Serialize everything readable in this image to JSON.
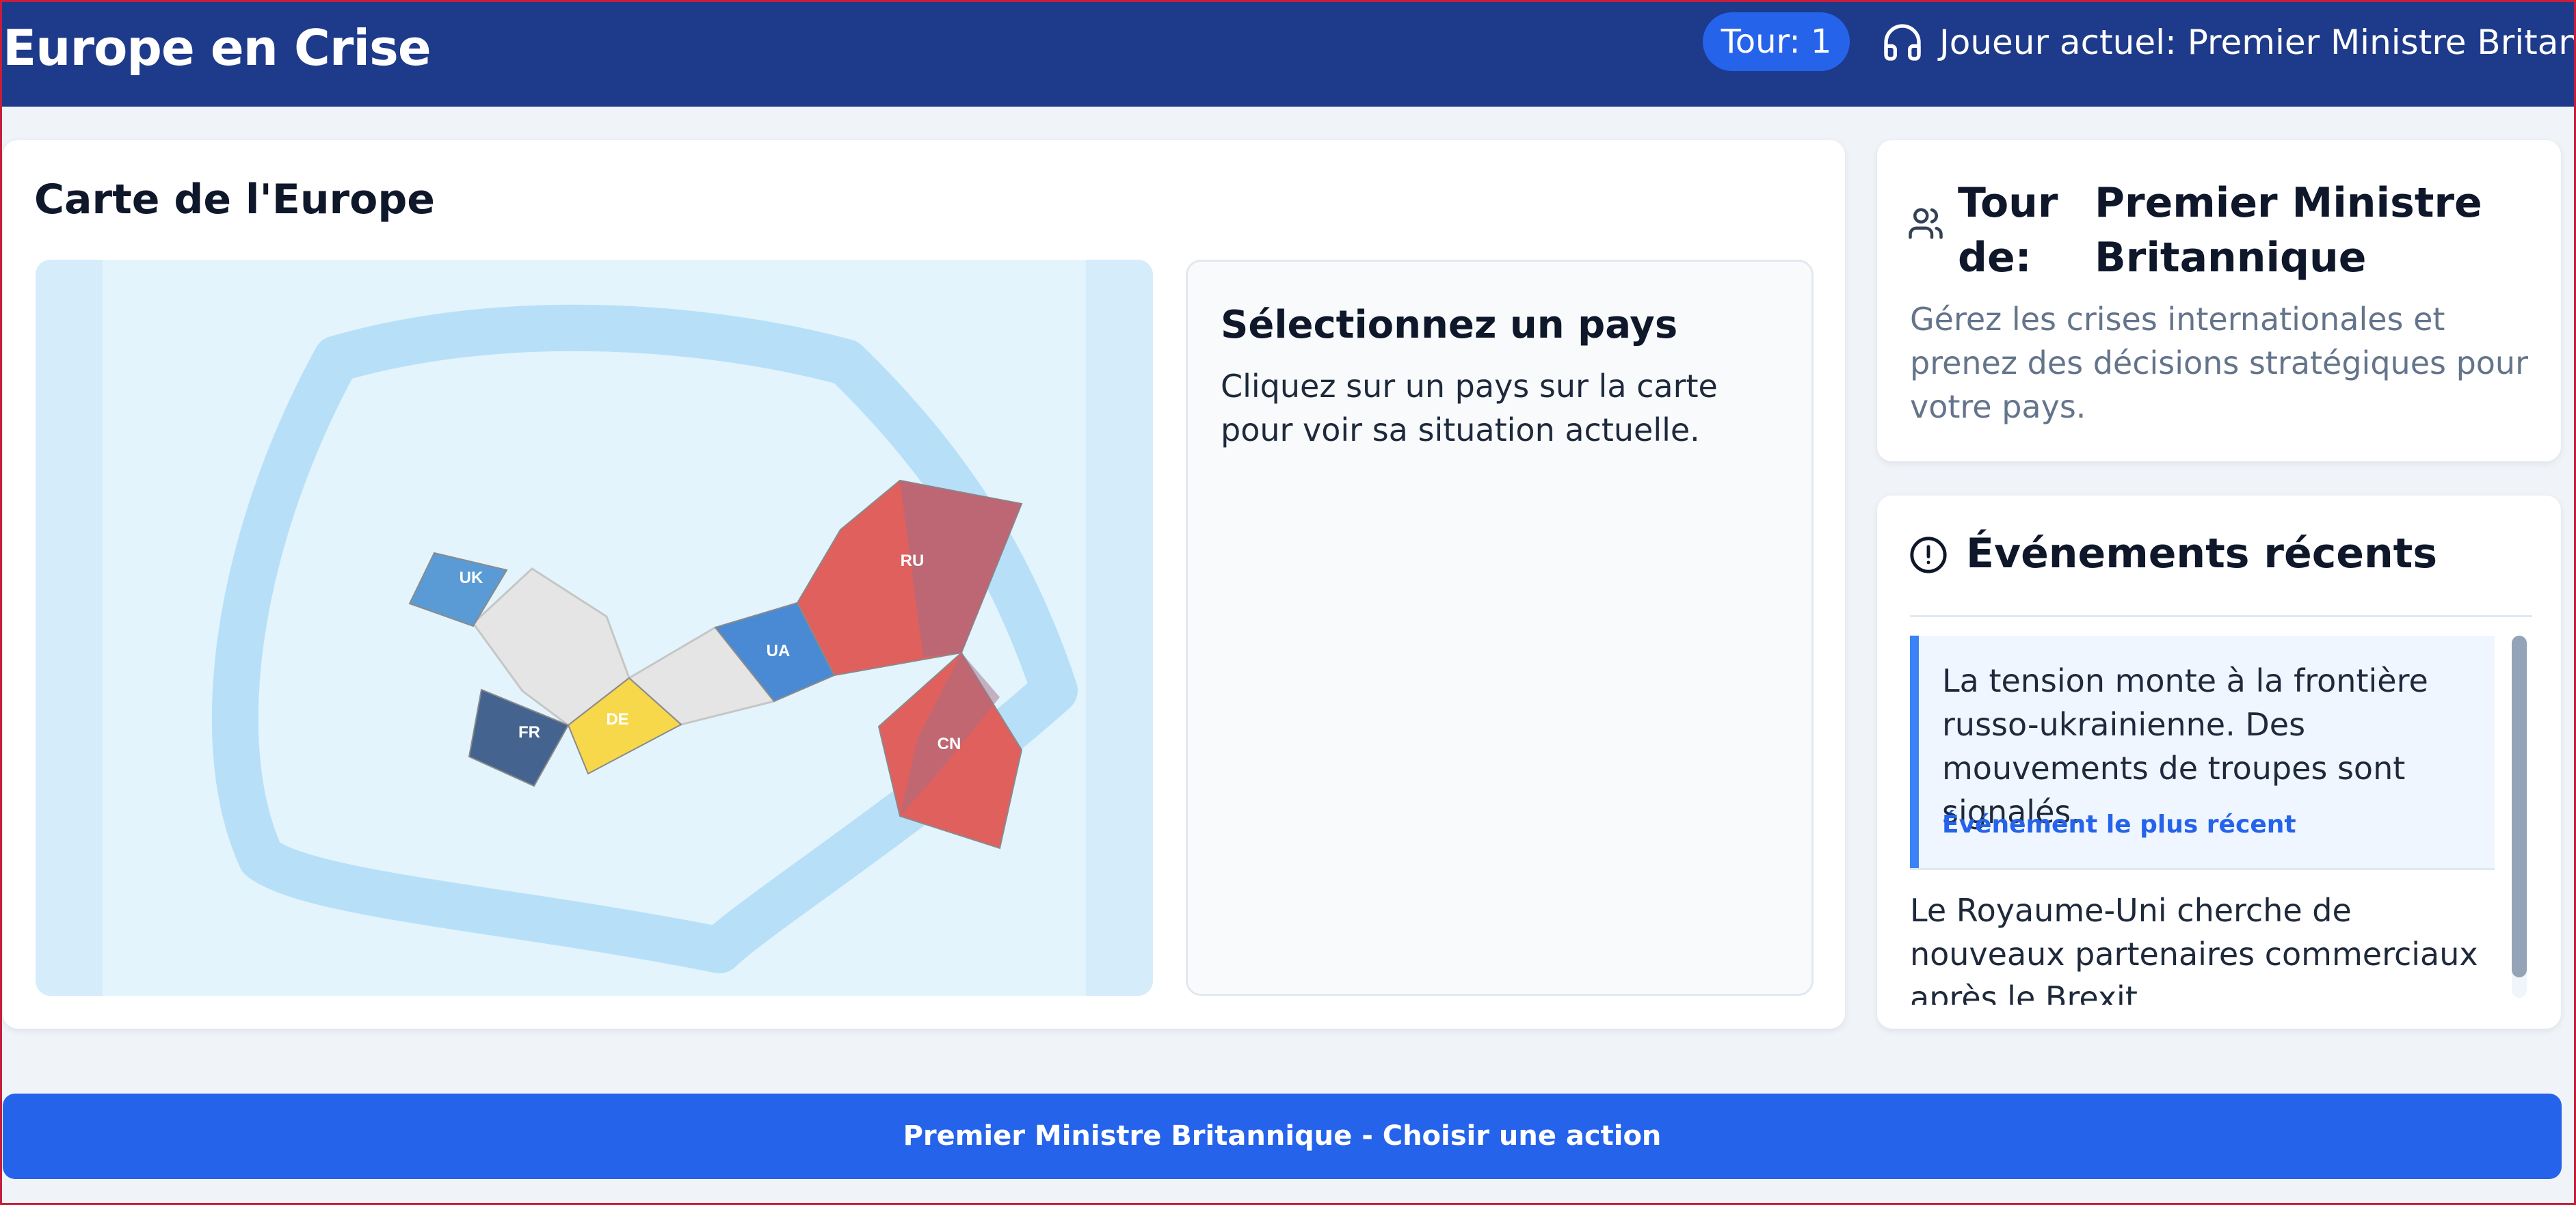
{
  "app": {
    "title": "Europe en Crise",
    "tour_badge": "Tour: 1",
    "current_player_label": "Joueur actuel: Premier Ministre Britannique"
  },
  "map": {
    "title": "Carte de l'Europe",
    "countries": [
      {
        "code": "UK",
        "color": "#5b9bd5"
      },
      {
        "code": "FR",
        "color": "#44648f"
      },
      {
        "code": "DE",
        "color": "#f7d84a"
      },
      {
        "code": "UA",
        "color": "#4a8ad4"
      },
      {
        "code": "RU",
        "color": "#e0605e"
      },
      {
        "code": "CN",
        "color": "#e0605e"
      }
    ],
    "neutral_color": "#e5e5e5"
  },
  "info_panel": {
    "title": "Sélectionnez un pays",
    "text": "Cliquez sur un pays sur la carte pour voir sa situation actuelle."
  },
  "turn": {
    "prefix": "Tour de:",
    "player": "Premier Ministre Britannique",
    "description": "Gérez les crises internationales et prenez des décisions stratégiques pour votre pays."
  },
  "events": {
    "title": "Événements récents",
    "items": [
      {
        "text": "La tension monte à la frontière russo-ukrainienne. Des mouvements de troupes sont signalés.",
        "tag": "Événement le plus récent"
      },
      {
        "text": "Le Royaume-Uni cherche de nouveaux partenaires commerciaux après le Brexit."
      }
    ]
  },
  "action": {
    "label": "Premier Ministre Britannique - Choisir une action"
  },
  "colors": {
    "header": "#1e3a8a",
    "accent": "#2563eb",
    "event_highlight": "#3b82f6"
  }
}
